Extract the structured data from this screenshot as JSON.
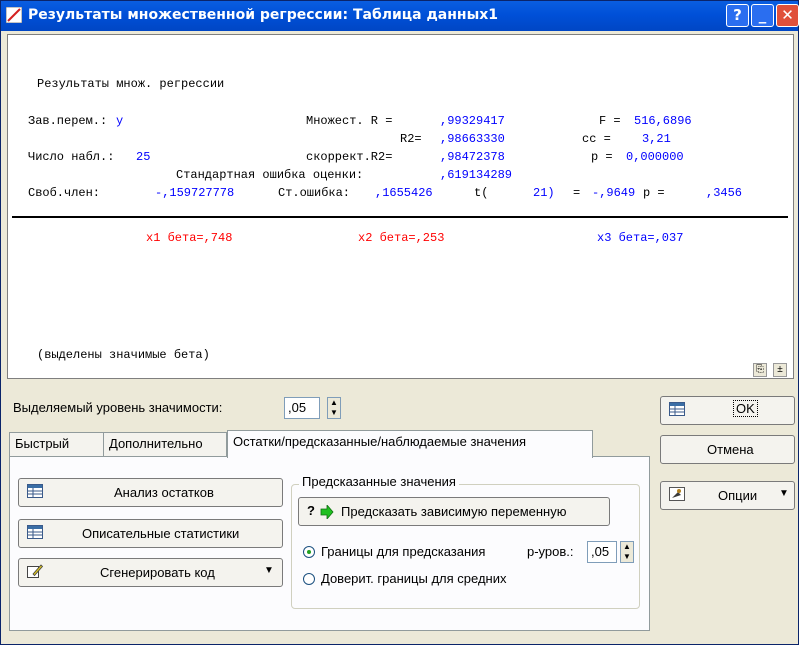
{
  "window": {
    "title": "Результаты множественной регрессии: Таблица данных1",
    "help_label": "?",
    "minimize_label": "_",
    "close_label": "✕"
  },
  "report": {
    "heading": "Результаты множ. регрессии",
    "dep_var_label": "Зав.перем.:",
    "dep_var_value": "y",
    "mult_r_label": "Множест. R =",
    "mult_r_value": ",99329417",
    "f_label": "F =",
    "f_value": "516,6896",
    "r2_label": "R2=",
    "r2_value": ",98663330",
    "cc_label": "сс =",
    "cc_value": "3,21",
    "n_obs_label": "Число набл.:",
    "n_obs_value": "25",
    "adj_r2_label": "скоррект.R2=",
    "adj_r2_value": ",98472378",
    "p_label": "p =",
    "p_value": "0,000000",
    "std_err_label": "Стандартная ошибка оценки:",
    "std_err_value": ",619134289",
    "intercept_label": "Своб.член:",
    "intercept_value": "-,159727778",
    "se_label": "Ст.ошибка:",
    "se_value": ",1655426",
    "t_label": "t(",
    "t_df": "21)",
    "t_eq": "=",
    "t_value": "-,9649",
    "p2_label": "p =",
    "p2_value": ",3456",
    "betas": [
      {
        "label": "x1 бета=,748"
      },
      {
        "label": "x2 бета=,253"
      },
      {
        "label": "x3 бета=,037"
      }
    ],
    "footer_note": "(выделены значимые бета)",
    "colors": {
      "blue": "#0000ff",
      "red": "#ff0000"
    }
  },
  "controls": {
    "significance_label": "Выделяемый уровень значимости:",
    "significance_value": ",05",
    "ok_label": "OK",
    "cancel_label": "Отмена",
    "options_label": "Опции",
    "tabs": [
      {
        "label": "Быстрый"
      },
      {
        "label": "Дополнительно"
      },
      {
        "label": "Остатки/предсказанные/наблюдаемые значения"
      }
    ],
    "residual_analysis_label": "Анализ остатков",
    "descriptive_stats_label": "Описательные статистики",
    "generate_code_label": "Сгенерировать код",
    "predicted_group_title": "Предсказанные значения",
    "predict_button_label": "Предсказать зависимую переменную",
    "prediction_bounds_label": "Границы для предсказания",
    "p_level_label": "p-уров.:",
    "p_level_value": ",05",
    "confidence_bounds_label": "Доверит. границы для средних"
  }
}
